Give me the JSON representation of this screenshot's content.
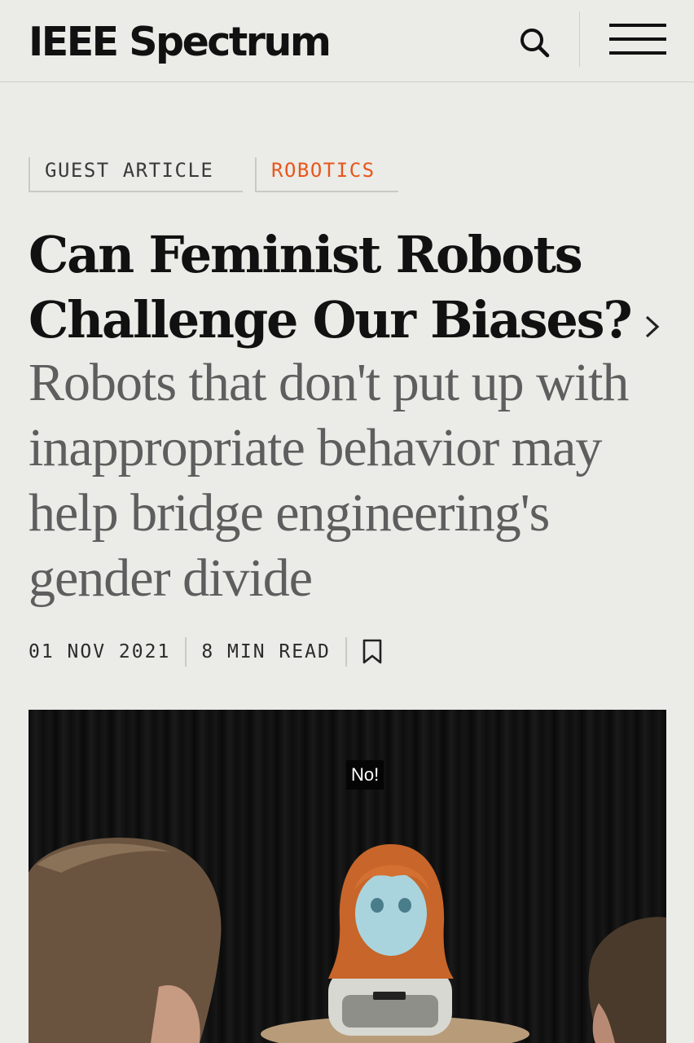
{
  "header": {
    "logo": "IEEE Spectrum",
    "search_icon": "search-icon",
    "menu_icon": "hamburger-menu-icon"
  },
  "tags": {
    "guest": "GUEST ARTICLE",
    "robotics": "ROBOTICS"
  },
  "article": {
    "title": "Can Feminist Robots Challenge Our Biases?",
    "subtitle": "Robots that don't put up with inappropriate behavior may help bridge engineering's gender divide",
    "date": "01 NOV 2021",
    "read_time": "8 MIN READ"
  },
  "hero": {
    "caption": "No!"
  },
  "colors": {
    "background": "#ebebe7",
    "accent": "#e8561c",
    "text": "#111111",
    "subtitle": "#5e5e5e"
  }
}
